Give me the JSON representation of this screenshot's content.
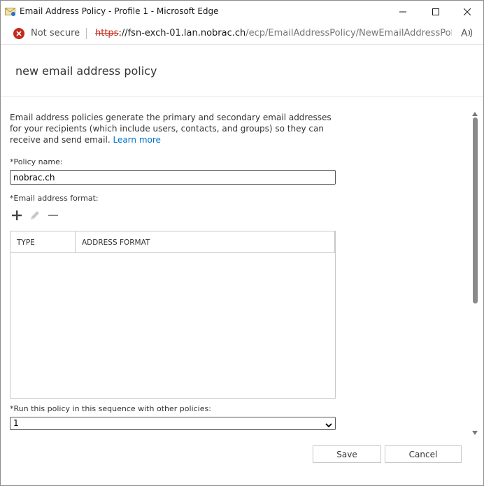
{
  "window": {
    "title": "Email Address Policy - Profile 1 - Microsoft Edge"
  },
  "addressbar": {
    "security_label": "Not secure",
    "url_scheme": "https",
    "url_host": "://fsn-exch-01.lan.nobrac.ch",
    "url_path": "/ecp/EmailAddressPolicy/NewEmailAddressPoli...",
    "read_aloud": "Aͅ"
  },
  "page": {
    "title": "new email address policy",
    "description": "Email address policies generate the primary and secondary email addresses for your recipients (which include users, contacts, and groups) so they can receive and send email.",
    "learn_more": "Learn more",
    "policy_name_label": "*Policy name:",
    "policy_name_value": "nobrac.ch",
    "email_format_label": "*Email address format:",
    "grid_columns": [
      "TYPE",
      "ADDRESS FORMAT"
    ],
    "sequence_label": "*Run this policy in this sequence with other policies:",
    "sequence_value": "1"
  },
  "footer": {
    "save_label": "Save",
    "cancel_label": "Cancel"
  },
  "icons": {
    "add": "plus-icon",
    "edit": "pencil-icon",
    "remove": "minus-icon"
  },
  "colors": {
    "link": "#0072c6",
    "insecure": "#c42b1c"
  }
}
